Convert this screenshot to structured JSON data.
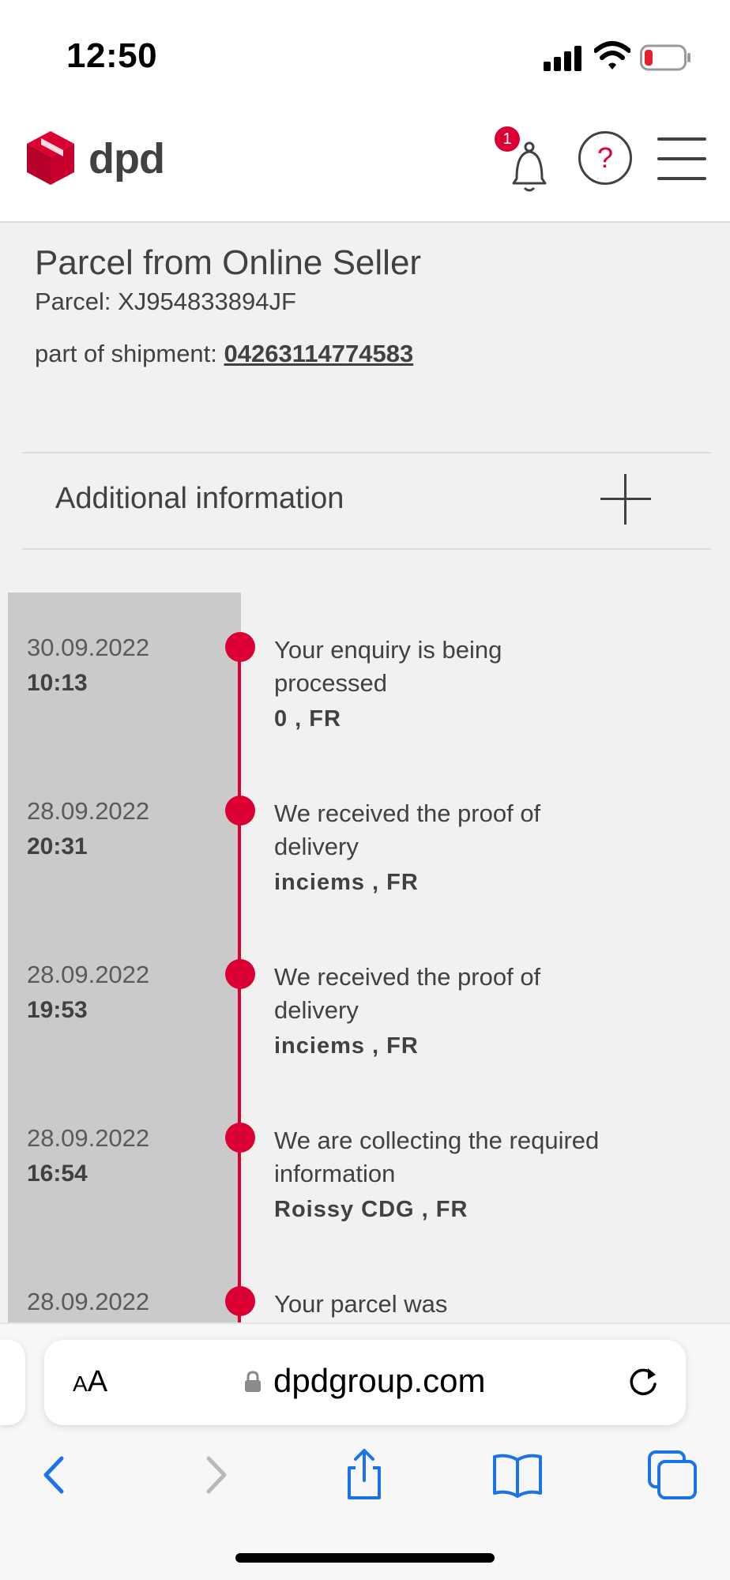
{
  "status_bar": {
    "time": "12:50"
  },
  "header": {
    "logo_text": "dpd",
    "notification_count": "1",
    "help_symbol": "?"
  },
  "parcel": {
    "title": "Parcel from Online Seller",
    "id_line": "Parcel: XJ954833894JF",
    "shipment_label": "part of shipment:",
    "shipment_number": "04263114774583"
  },
  "additional_info": {
    "label": "Additional information"
  },
  "events": [
    {
      "date": "30.09.2022",
      "time": "10:13",
      "description": "Your enquiry is being processed",
      "location": "0 , FR"
    },
    {
      "date": "28.09.2022",
      "time": "20:31",
      "description": "We received the proof of delivery",
      "location": "inciems , FR"
    },
    {
      "date": "28.09.2022",
      "time": "19:53",
      "description": "We received the proof of delivery",
      "location": "inciems , FR"
    },
    {
      "date": "28.09.2022",
      "time": "16:54",
      "description": "We are collecting the required information",
      "location": "Roissy CDG , FR"
    },
    {
      "date": "28.09.2022",
      "time": "",
      "description": "Your parcel was",
      "location": ""
    }
  ],
  "browser": {
    "aa_label_big": "A",
    "aa_label_small": "A",
    "url": "dpdgroup.com"
  },
  "colors": {
    "brand_red": "#dc0032",
    "text_dark": "#414042",
    "content_bg": "#f0f1f1",
    "date_column_bg": "#cacaca",
    "safari_blue": "#1a73e8"
  },
  "icons": {
    "logo": "dpd-cube-icon",
    "notification": "bell-icon",
    "help": "help-circle-icon",
    "menu": "hamburger-menu-icon",
    "expand": "plus-icon",
    "back": "chevron-left-icon",
    "forward": "chevron-right-icon",
    "share": "share-icon",
    "bookmarks": "book-icon",
    "tabs": "tabs-icon",
    "reload": "reload-icon",
    "lock": "lock-icon"
  }
}
